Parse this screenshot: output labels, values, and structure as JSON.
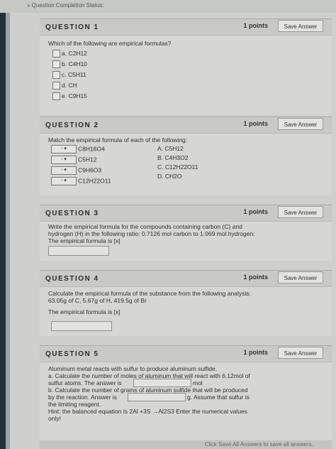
{
  "header": {
    "completion_label": "» Question Completion Status:"
  },
  "q1": {
    "title": "QUESTION 1",
    "points": "1 points",
    "save_label": "Save Answer",
    "prompt": "Which of the following are empirical formulas?",
    "options": [
      "a. C2H12",
      "b. C4H10",
      "c. C5H11",
      "d. CH",
      "e. C9H15"
    ]
  },
  "q2": {
    "title": "QUESTION 2",
    "points": "1 points",
    "save_label": "Save Answer",
    "prompt": "Match the empirical formula of each of the following:",
    "left_items": [
      "C8H16O4",
      "C5H12",
      "C9H6O3",
      "C12H22O11"
    ],
    "right_items": [
      "A. C5H12",
      "B. C4H3O2",
      "C. C12H22O11",
      "D. CH2O"
    ]
  },
  "q3": {
    "title": "QUESTION 3",
    "points": "1 points",
    "save_label": "Save Answer",
    "prompt_line1": "Write the empirical formula for the compounds containing carbon (C)  and",
    "prompt_line2": "hydrogen (H) in the following ratio: 0.7126 mol carbon to 1.069 mol hydrogen:",
    "prompt_line3": "The empirical formula is [x]"
  },
  "q4": {
    "title": "QUESTION 4",
    "points": "1 points",
    "save_label": "Save Answer",
    "prompt_line1": "Calculate the empirical formula of the substance from the following analysis:",
    "prompt_line2": "63.05g of C, 5.67g of H, 419.5g of Br",
    "prompt_line3": "The empirical formula is [x]"
  },
  "q5": {
    "title": "QUESTION 5",
    "points": "1 points",
    "save_label": "Save Answer",
    "line1": "Aluminum metal reacts with sulfur to produce aluminum sulfide.",
    "line2": "a. Calculate the number of moles of aluminum that will react with 6.12mol of",
    "line3a": "sulfur atoms. The answer is",
    "line3b": "mol",
    "line4": "b. Calculate the number of grams of aluminum sulfide that will be produced",
    "line5a": "by the reaction. Answer is",
    "line5b": "g. Assume that sulfur is",
    "line6": "the limiting reagent.",
    "line7": "Hint: the balanced equation is 2Al +3S →Al2S3 Enter the numerical values",
    "line8": "only!"
  },
  "footer": {
    "text": "Click Save All Answers to save all answers."
  }
}
